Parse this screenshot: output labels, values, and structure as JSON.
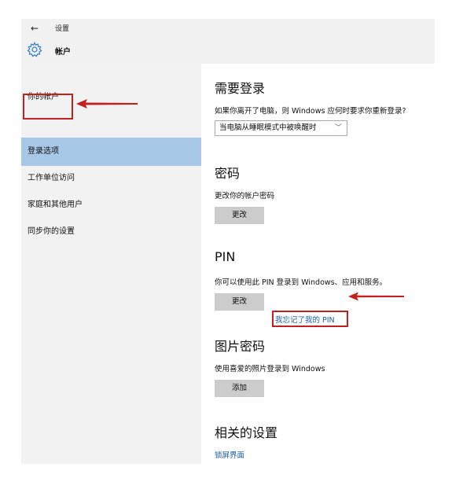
{
  "titlebar": {
    "back_glyph": "←",
    "title": "设置",
    "app_icon": "gear-icon",
    "app_title": "帐户"
  },
  "sidebar": {
    "items": [
      {
        "label": "你的帐户",
        "selected": false
      },
      {
        "label": "登录选项",
        "selected": true
      },
      {
        "label": "工作单位访问",
        "selected": false
      },
      {
        "label": "家庭和其他用户",
        "selected": false
      },
      {
        "label": "同步你的设置",
        "selected": false
      }
    ]
  },
  "main": {
    "require_signin": {
      "heading": "需要登录",
      "description": "如果你离开了电脑，则 Windows 应何时要求你重新登录?",
      "dropdown_value": "当电脑从睡眠模式中被唤醒时"
    },
    "password": {
      "heading": "密码",
      "description": "更改你的帐户密码",
      "button": "更改"
    },
    "pin": {
      "heading": "PIN",
      "description": "你可以使用此 PIN 登录到 Windows、应用和服务。",
      "button": "更改",
      "forgot_link": "我忘记了我的 PIN"
    },
    "picture_password": {
      "heading": "图片密码",
      "description": "使用喜爱的照片登录到 Windows",
      "button": "添加"
    },
    "related": {
      "heading": "相关的设置",
      "link": "锁屏界面"
    }
  },
  "colors": {
    "selected_nav": "#a7c9e7",
    "annotation_red": "#c0201f",
    "link_blue": "#1a5fa8"
  }
}
